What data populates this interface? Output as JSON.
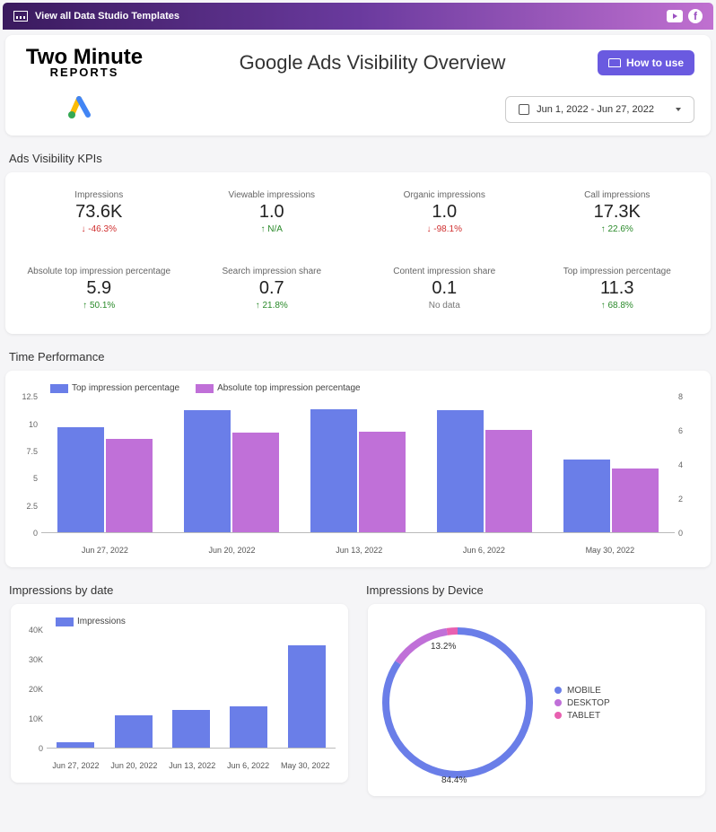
{
  "topbar": {
    "link": "View all Data Studio Templates"
  },
  "header": {
    "logo_line1": "Two Minute",
    "logo_line2": "REPORTS",
    "title": "Google Ads Visibility Overview",
    "how_to_use": "How to use",
    "date_range": "Jun 1, 2022 - Jun 27, 2022"
  },
  "sections": {
    "kpis_title": "Ads Visibility KPIs",
    "time_title": "Time Performance",
    "imp_date_title": "Impressions by date",
    "imp_device_title": "Impressions by Device"
  },
  "kpis": {
    "row1": [
      {
        "label": "Impressions",
        "value": "73.6K",
        "delta": "↓ -46.3%",
        "dir": "down"
      },
      {
        "label": "Viewable impressions",
        "value": "1.0",
        "delta": "↑ N/A",
        "dir": "up"
      },
      {
        "label": "Organic impressions",
        "value": "1.0",
        "delta": "↓ -98.1%",
        "dir": "down"
      },
      {
        "label": "Call impressions",
        "value": "17.3K",
        "delta": "↑ 22.6%",
        "dir": "up"
      }
    ],
    "row2": [
      {
        "label": "Absolute top impression percentage",
        "value": "5.9",
        "delta": "↑ 50.1%",
        "dir": "up"
      },
      {
        "label": "Search impression share",
        "value": "0.7",
        "delta": "↑ 21.8%",
        "dir": "up"
      },
      {
        "label": "Content impression share",
        "value": "0.1",
        "delta": "No data",
        "dir": "neutral"
      },
      {
        "label": "Top impression percentage",
        "value": "11.3",
        "delta": "↑ 68.8%",
        "dir": "up"
      }
    ]
  },
  "colors": {
    "blue": "#6a7ee8",
    "purple": "#c070d8",
    "pink": "#e860b0"
  },
  "chart_data": [
    {
      "id": "time_performance",
      "type": "bar",
      "categories": [
        "Jun 27, 2022",
        "Jun 20, 2022",
        "Jun 13, 2022",
        "Jun 6, 2022",
        "May 30, 2022"
      ],
      "series": [
        {
          "name": "Top impression percentage",
          "color": "#6a7ee8",
          "values": [
            9.7,
            11.3,
            11.4,
            11.3,
            6.7
          ]
        },
        {
          "name": "Absolute top impression percentage",
          "color": "#c070d8",
          "values": [
            8.6,
            9.2,
            9.3,
            9.5,
            5.9
          ]
        }
      ],
      "ylim_left": [
        0,
        12.5
      ],
      "yticks_left": [
        0,
        2.5,
        5,
        7.5,
        10,
        12.5
      ],
      "ylim_right": [
        0,
        8
      ],
      "yticks_right": [
        0,
        2,
        4,
        6,
        8
      ],
      "legend_text": [
        "Top impression percentage",
        "Absolute top impression percentage"
      ]
    },
    {
      "id": "impressions_by_date",
      "type": "bar",
      "categories": [
        "Jun 27, 2022",
        "Jun 20, 2022",
        "Jun 13, 2022",
        "Jun 6, 2022",
        "May 30, 2022"
      ],
      "series": [
        {
          "name": "Impressions",
          "color": "#6a7ee8",
          "values": [
            2000,
            11000,
            13000,
            14000,
            35000
          ]
        }
      ],
      "ylim": [
        0,
        40000
      ],
      "yticks": [
        0,
        "10K",
        "20K",
        "30K",
        "40K"
      ],
      "legend_text": [
        "Impressions"
      ]
    },
    {
      "id": "impressions_by_device",
      "type": "pie",
      "slices": [
        {
          "name": "MOBILE",
          "value": 84.4,
          "color": "#6a7ee8"
        },
        {
          "name": "DESKTOP",
          "value": 13.2,
          "color": "#c070d8"
        },
        {
          "name": "TABLET",
          "value": 2.4,
          "color": "#e860b0"
        }
      ],
      "labels": {
        "mobile": "84.4%",
        "desktop": "13.2%"
      }
    }
  ]
}
